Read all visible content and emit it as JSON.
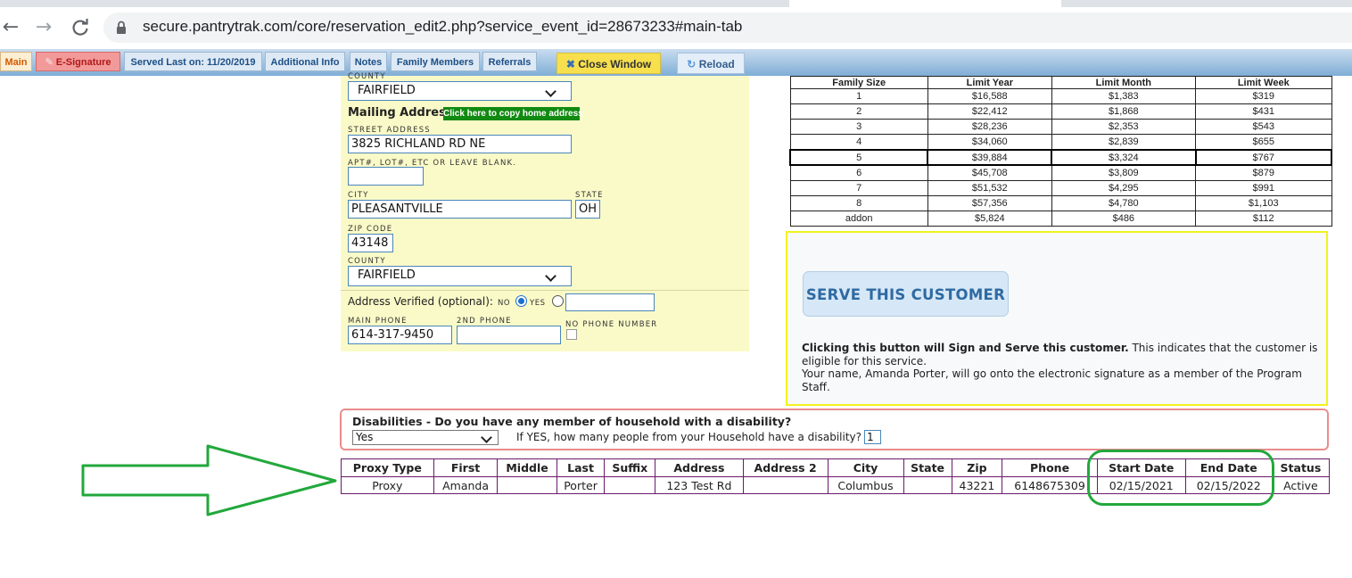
{
  "browser": {
    "url": "secure.pantrytrak.com/core/reservation_edit2.php?service_event_id=28673233#main-tab",
    "back_glyph": "←",
    "forward_glyph": "→",
    "reload_glyph": "C"
  },
  "tabs": {
    "main": "Main",
    "esignature": "E-Signature",
    "served_last": "Served Last on: 11/20/2019",
    "additional_info": "Additional Info",
    "notes": "Notes",
    "family_members": "Family Members",
    "referrals": "Referrals",
    "close_window": "Close Window",
    "reload": "Reload"
  },
  "form": {
    "county_top_label": "COUNTY",
    "county_top_value": "FAIRFIELD",
    "mailing_title": "Mailing Address",
    "copy_button": "Click here to copy home address",
    "street_label": "STREET ADDRESS",
    "street_value": "3825 RICHLAND RD NE",
    "apt_label": "APT#, LOT#, ETC OR LEAVE BLANK.",
    "apt_value": "",
    "city_label": "CITY",
    "city_value": "PLEASANTVILLE",
    "state_label": "STATE",
    "state_value": "OH",
    "zip_label": "ZIP CODE",
    "zip_value": "43148",
    "county_label": "COUNTY",
    "county_value": "FAIRFIELD",
    "verified_label": "Address Verified (optional):",
    "verified_no": "NO",
    "verified_yes": "YES",
    "verified_value": "",
    "main_phone_label": "MAIN PHONE",
    "main_phone_value": "614-317-9450",
    "phone2_label": "2ND PHONE",
    "phone2_value": "",
    "no_phone_label": "NO PHONE NUMBER"
  },
  "limits": {
    "headers": [
      "Family Size",
      "Limit Year",
      "Limit Month",
      "Limit Week"
    ],
    "rows": [
      [
        "1",
        "$16,588",
        "$1,383",
        "$319"
      ],
      [
        "2",
        "$22,412",
        "$1,868",
        "$431"
      ],
      [
        "3",
        "$28,236",
        "$2,353",
        "$543"
      ],
      [
        "4",
        "$34,060",
        "$2,839",
        "$655"
      ],
      [
        "5",
        "$39,884",
        "$3,324",
        "$767"
      ],
      [
        "6",
        "$45,708",
        "$3,809",
        "$879"
      ],
      [
        "7",
        "$51,532",
        "$4,295",
        "$991"
      ],
      [
        "8",
        "$57,356",
        "$4,780",
        "$1,103"
      ],
      [
        "addon",
        "$5,824",
        "$486",
        "$112"
      ]
    ],
    "selected_row": 4
  },
  "serve": {
    "button": "SERVE THIS CUSTOMER",
    "bold_text": "Clicking this button will Sign and Serve this customer.",
    "text1": " This indicates that the customer is eligible for this service.",
    "text2": "Your name, Amanda Porter, will go onto the electronic signature as a member of the Program Staff."
  },
  "disabilities": {
    "question": "Disabilities - Do you have any member of household with a disability?",
    "selected": "Yes",
    "count_question": "If YES, how many people from your Household have a disability?",
    "count_value": "1"
  },
  "proxy": {
    "headers": [
      "Proxy Type",
      "First",
      "Middle",
      "Last",
      "Suffix",
      "Address",
      "Address 2",
      "City",
      "State",
      "Zip",
      "Phone",
      "Start Date",
      "End Date",
      "Status"
    ],
    "rows": [
      [
        "Proxy",
        "Amanda",
        "",
        "Porter",
        "",
        "123 Test Rd",
        "",
        "Columbus",
        "",
        "43221",
        "6148675309",
        "02/15/2021",
        "02/15/2022",
        "Active"
      ]
    ]
  },
  "colors": {
    "annotation_green": "#22a83c",
    "serve_border": "#f2f21c",
    "disability_border": "#ea8c8c",
    "form_bg": "#fafac8",
    "copy_button_bg": "#118a11"
  }
}
